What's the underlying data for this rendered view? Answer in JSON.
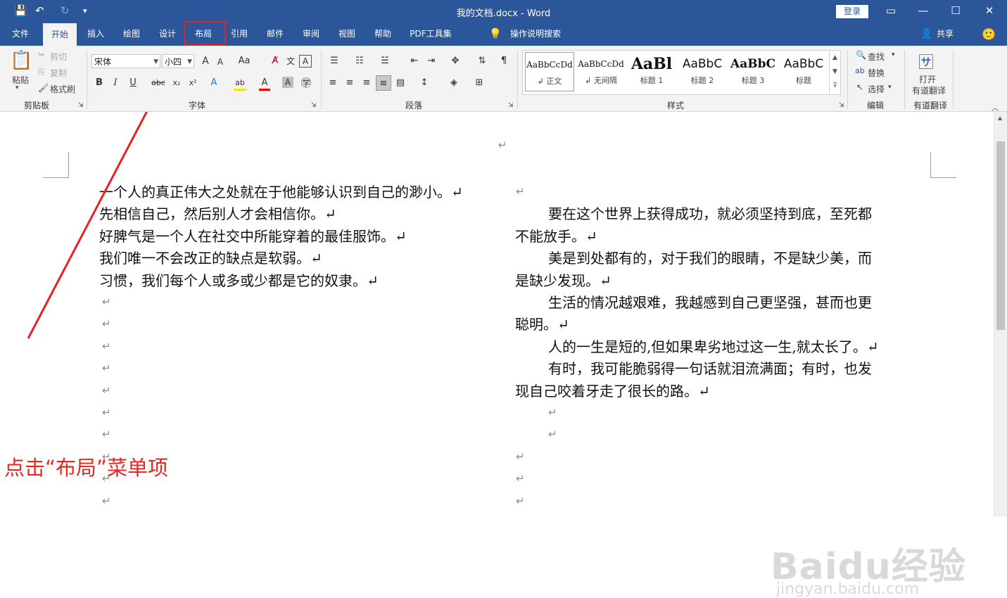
{
  "window": {
    "title": "我的文档.docx  -  Word",
    "login_label": "登录",
    "controls": [
      "▭",
      "—",
      "☐",
      "✕"
    ]
  },
  "quick_access": {
    "save": "💾",
    "undo": "↶",
    "redo": "↻",
    "customize": "▾"
  },
  "tabs": [
    "文件",
    "开始",
    "插入",
    "绘图",
    "设计",
    "布局",
    "引用",
    "邮件",
    "审阅",
    "视图",
    "帮助",
    "PDF工具集"
  ],
  "active_tab": "开始",
  "highlighted_tab": "布局",
  "tell_me": "操作说明搜索",
  "share_label": "共享",
  "ribbon": {
    "clipboard": {
      "label": "剪贴板",
      "paste": "粘贴",
      "cut": "剪切",
      "copy": "复制",
      "format_painter": "格式刷"
    },
    "font": {
      "label": "字体",
      "font_name": "宋体",
      "font_size": "小四",
      "bold": "B",
      "italic": "I",
      "underline": "U",
      "strike": "abc",
      "subscript": "x₂",
      "superscript": "x²",
      "change_case": "Aa",
      "grow": "A",
      "shrink": "A"
    },
    "paragraph": {
      "label": "段落"
    },
    "styles": {
      "label": "样式",
      "items": [
        {
          "preview": "AaBbCcDd",
          "name": "↲ 正文"
        },
        {
          "preview": "AaBbCcDd",
          "name": "↲ 无间隔"
        },
        {
          "preview": "AaBl",
          "name": "标题 1"
        },
        {
          "preview": "AaBbC",
          "name": "标题 2"
        },
        {
          "preview": "AaBbC",
          "name": "标题 3"
        },
        {
          "preview": "AaBbC",
          "name": "标题"
        }
      ]
    },
    "editing": {
      "label": "编辑",
      "find": "查找",
      "replace": "替换",
      "select": "选择"
    },
    "youdao": {
      "label": "有道翻译",
      "open": "打开",
      "open2": "有道翻译"
    }
  },
  "document": {
    "top_mark": "↵",
    "left_lines": [
      "一个人的真正伟大之处就在于他能够认识到自己的渺小。↵",
      "先相信自己，然后别人才会相信你。↵",
      "好脾气是一个人在社交中所能穿着的最佳服饰。↵",
      "我们唯一不会改正的缺点是软弱。↵",
      "习惯，我们每个人或多或少都是它的奴隶。↵"
    ],
    "left_empty_count": 10,
    "right_lines": [
      "↵",
      "要在这个世界上获得成功，就必须坚持到底，至死都",
      "不能放手。↵",
      "美是到处都有的，对于我们的眼睛，不是缺少美，而",
      "是缺少发现。↵",
      "生活的情况越艰难，我越感到自己更坚强，甚而也更",
      "聪明。↵",
      "人的一生是短的,但如果卑劣地过这一生,就太长了。↵",
      "有时，我可能脆弱得一句话就泪流满面；有时，也发",
      "现自己咬着牙走了很长的路。↵"
    ],
    "right_empty_indented": 2,
    "right_empty_count": 3,
    "pilcrow": "↵"
  },
  "annotation": "点击“布局”菜单项",
  "watermark": {
    "brand": "Baidu经验",
    "url": "jingyan.baidu.com"
  },
  "colors": {
    "title_bar": "#2b579a",
    "annotation": "#e8261f"
  }
}
